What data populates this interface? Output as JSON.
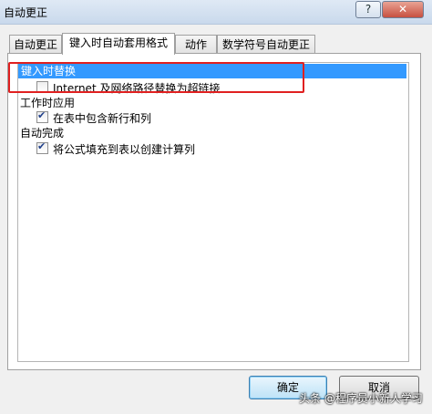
{
  "window": {
    "title": "自动更正",
    "help_label": "?",
    "close_label": "✕"
  },
  "tabs": [
    {
      "label": "自动更正"
    },
    {
      "label": "键入时自动套用格式"
    },
    {
      "label": "动作"
    },
    {
      "label": "数学符号自动更正"
    }
  ],
  "groups": {
    "replace_heading": "键入时替换",
    "replace_internet": {
      "label": "Internet 及网络路径替换为超链接",
      "checked": false
    },
    "apply_heading": "工作时应用",
    "apply_rows": {
      "label": "在表中包含新行和列",
      "checked": true
    },
    "complete_heading": "自动完成",
    "complete_formula": {
      "label": "将公式填充到表以创建计算列",
      "checked": true
    }
  },
  "buttons": {
    "ok": "确定",
    "cancel": "取消"
  },
  "watermark": "头条 @程序员小新人学习",
  "colors": {
    "selection": "#3399ff",
    "highlight_box": "#e02020"
  }
}
